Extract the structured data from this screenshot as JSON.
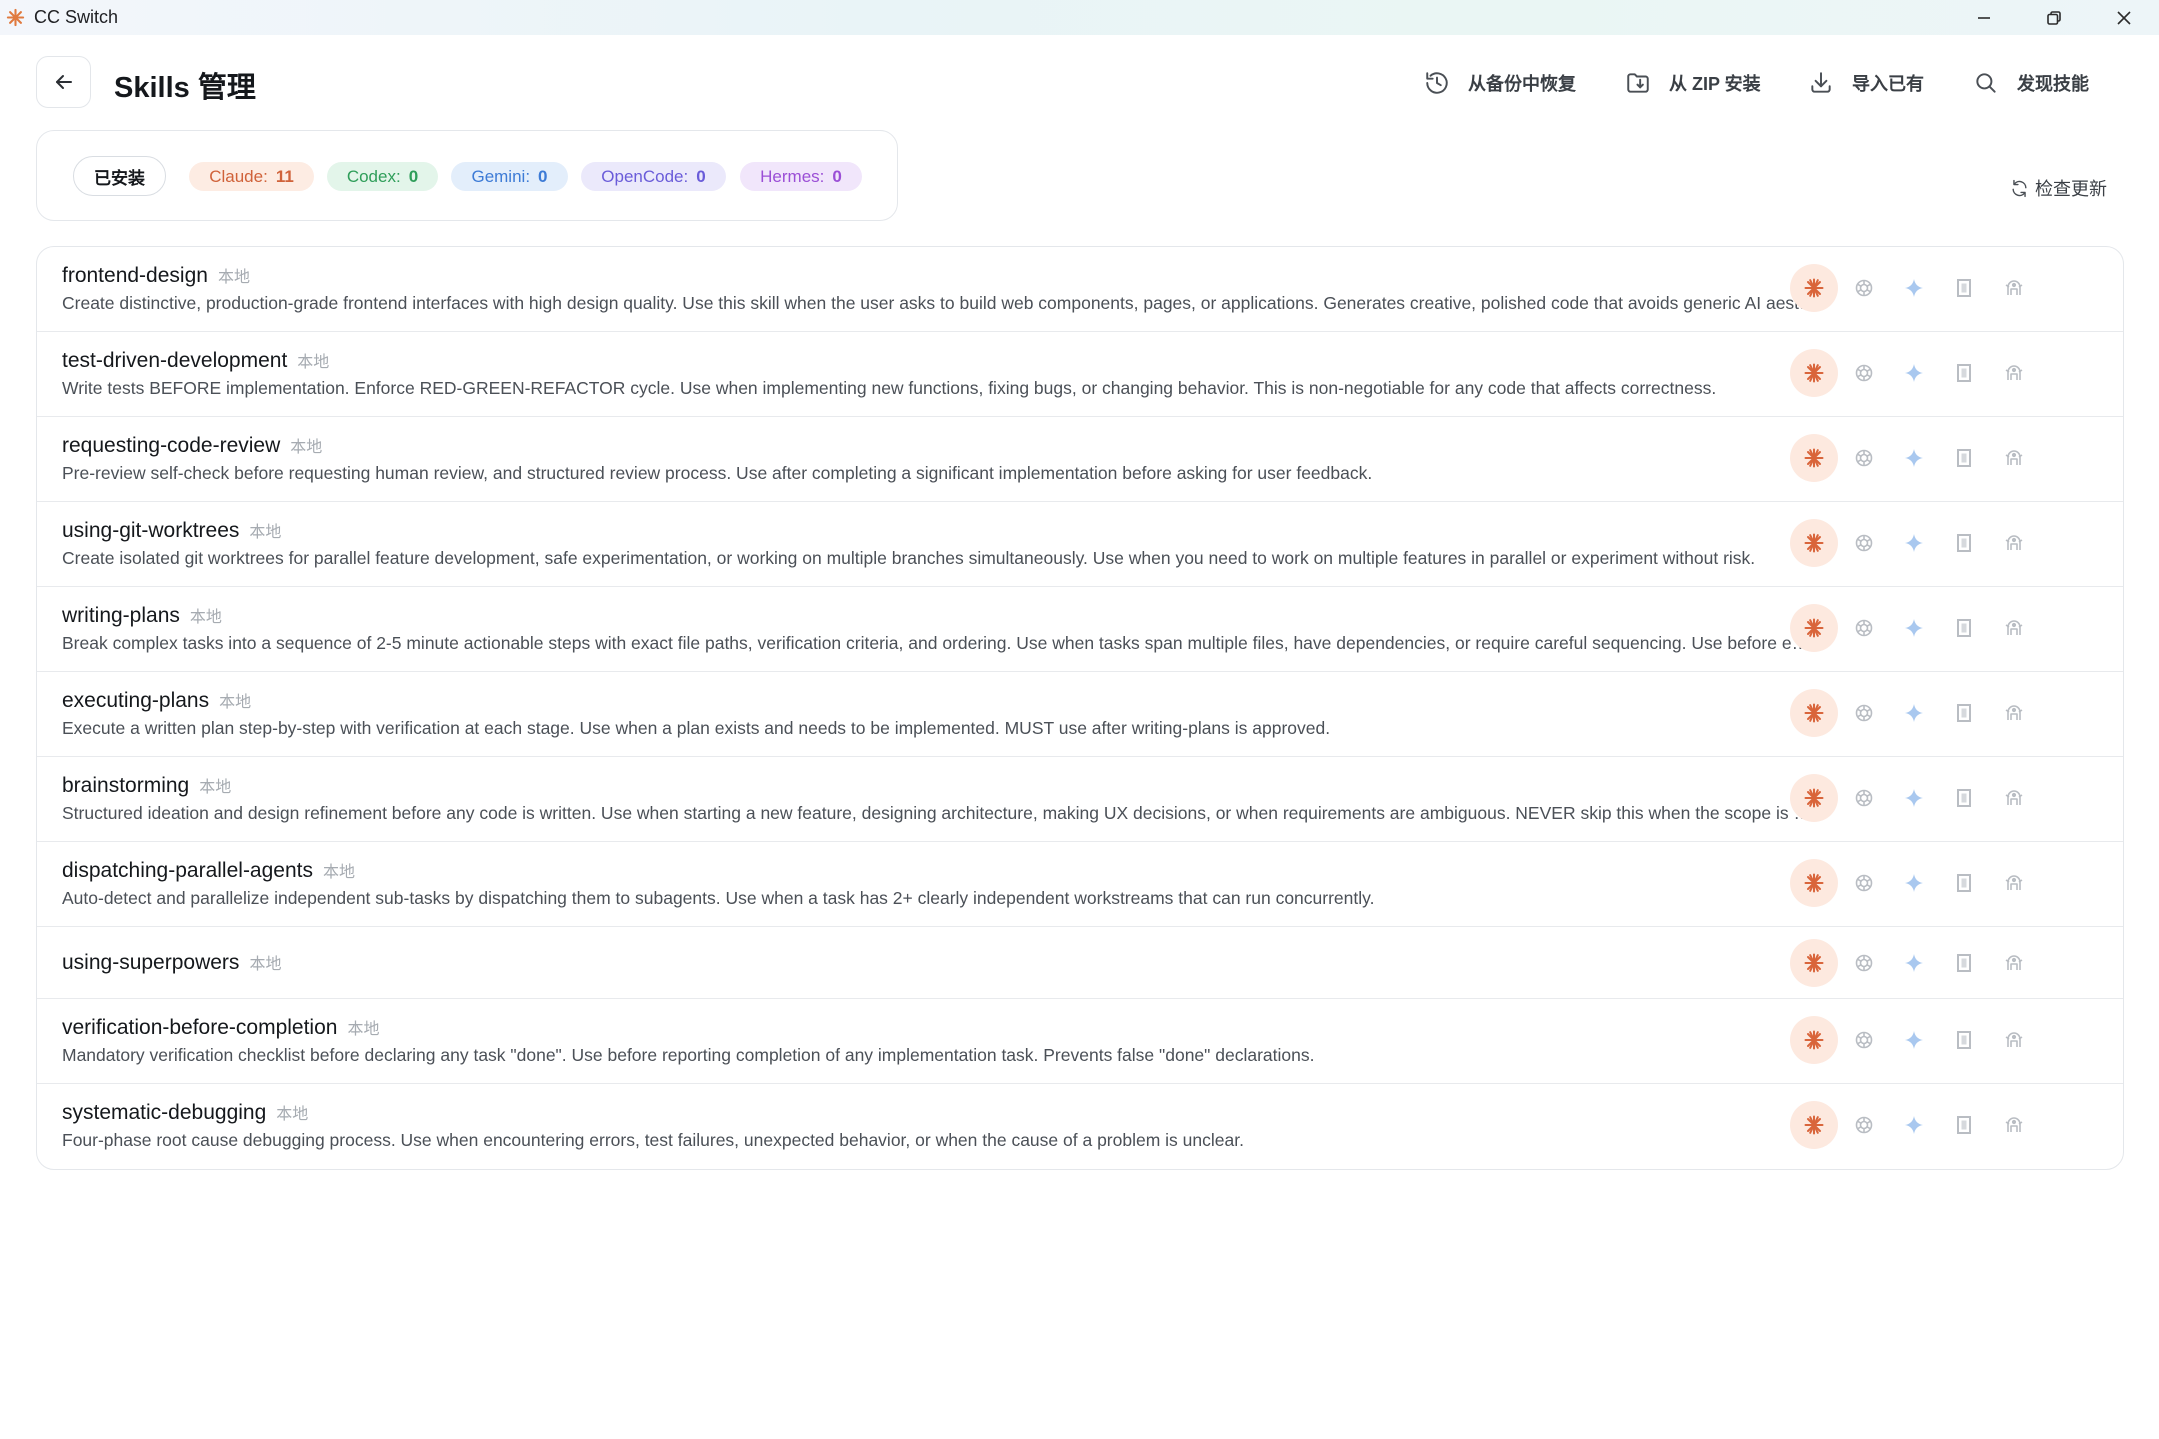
{
  "window": {
    "title": "CC Switch"
  },
  "header": {
    "page_title": "Skills 管理",
    "actions": {
      "restore_backup": "从备份中恢复",
      "install_zip": "从 ZIP 安装",
      "import_existing": "导入已有",
      "discover_skills": "发现技能"
    }
  },
  "filters": {
    "installed_label": "已安装",
    "apps": [
      {
        "label": "Claude:",
        "count": "11",
        "bg": "#fdece3",
        "fg": "#d0623a"
      },
      {
        "label": "Codex:",
        "count": "0",
        "bg": "#e3f5ea",
        "fg": "#2f9e5a"
      },
      {
        "label": "Gemini:",
        "count": "0",
        "bg": "#e3eefb",
        "fg": "#3d7bd6"
      },
      {
        "label": "OpenCode:",
        "count": "0",
        "bg": "#ebe9fb",
        "fg": "#6a5cd9"
      },
      {
        "label": "Hermes:",
        "count": "0",
        "bg": "#f1e6fb",
        "fg": "#9b4fd6"
      }
    ],
    "check_updates": "检查更新"
  },
  "skills": [
    {
      "name": "frontend-design",
      "tag": "本地",
      "description": "Create distinctive, production-grade frontend interfaces with high design quality. Use this skill when the user asks to build web components, pages, or applications. Generates creative, polished code that avoids generic AI aesthetics."
    },
    {
      "name": "test-driven-development",
      "tag": "本地",
      "description": "Write tests BEFORE implementation. Enforce RED-GREEN-REFACTOR cycle. Use when implementing new functions, fixing bugs, or changing behavior. This is non-negotiable for any code that affects correctness."
    },
    {
      "name": "requesting-code-review",
      "tag": "本地",
      "description": "Pre-review self-check before requesting human review, and structured review process. Use after completing a significant implementation before asking for user feedback."
    },
    {
      "name": "using-git-worktrees",
      "tag": "本地",
      "description": "Create isolated git worktrees for parallel feature development, safe experimentation, or working on multiple branches simultaneously. Use when you need to work on multiple features in parallel or experiment without risk."
    },
    {
      "name": "writing-plans",
      "tag": "本地",
      "description": "Break complex tasks into a sequence of 2-5 minute actionable steps with exact file paths, verification criteria, and ordering. Use when tasks span multiple files, have dependencies, or require careful sequencing. Use before executing."
    },
    {
      "name": "executing-plans",
      "tag": "本地",
      "description": "Execute a written plan step-by-step with verification at each stage. Use when a plan exists and needs to be implemented. MUST use after writing-plans is approved."
    },
    {
      "name": "brainstorming",
      "tag": "本地",
      "description": "Structured ideation and design refinement before any code is written. Use when starting a new feature, designing architecture, making UX decisions, or when requirements are ambiguous. NEVER skip this when the scope is unclear."
    },
    {
      "name": "dispatching-parallel-agents",
      "tag": "本地",
      "description": "Auto-detect and parallelize independent sub-tasks by dispatching them to subagents. Use when a task has 2+ clearly independent workstreams that can run concurrently."
    },
    {
      "name": "using-superpowers",
      "tag": "本地",
      "description": ""
    },
    {
      "name": "verification-before-completion",
      "tag": "本地",
      "description": "Mandatory verification checklist before declaring any task \"done\". Use before reporting completion of any implementation task. Prevents false \"done\" declarations."
    },
    {
      "name": "systematic-debugging",
      "tag": "本地",
      "description": "Four-phase root cause debugging process. Use when encountering errors, test failures, unexpected behavior, or when the cause of a problem is unclear."
    }
  ],
  "toggle_icons": [
    "claude-icon",
    "openai-icon",
    "gemini-icon",
    "opencode-icon",
    "hermes-icon"
  ],
  "colors": {
    "claude_accent": "#d9653b",
    "claude_bg": "#fde9df",
    "inactive_icon": "#b9bdc3",
    "gemini_icon": "#a9c8ef"
  }
}
